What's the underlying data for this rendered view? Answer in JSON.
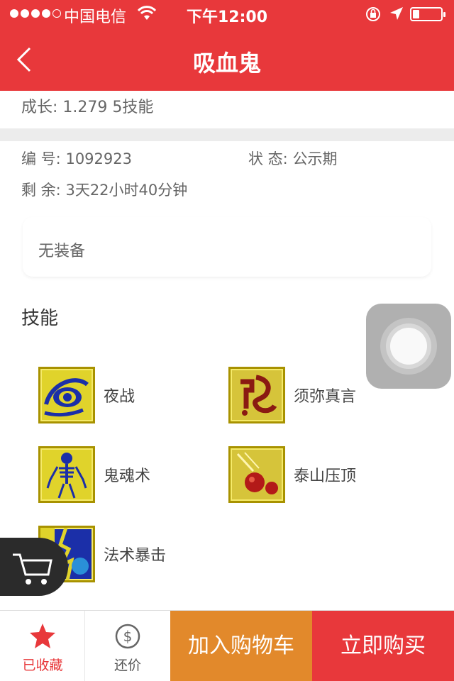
{
  "status_bar": {
    "carrier": "中国电信",
    "time": "下午12:00",
    "signal_level": 4,
    "battery_percent": 15
  },
  "nav": {
    "title": "吸血鬼",
    "back_icon": "chevron-left-icon"
  },
  "summary": {
    "growth": "成长: 1.279   5技能"
  },
  "info": {
    "id_label": "编  号:",
    "id_value": "1092923",
    "state_label": "状  态:",
    "state_value": "公示期",
    "remaining_label": "剩  余:",
    "remaining_value": "3天22小时40分钟"
  },
  "equipment": {
    "text": "无装备"
  },
  "skills": {
    "title": "技能",
    "items": [
      {
        "name": "夜战",
        "icon": "eye-icon"
      },
      {
        "name": "须弥真言",
        "icon": "rune-icon"
      },
      {
        "name": "鬼魂术",
        "icon": "skeleton-icon"
      },
      {
        "name": "泰山压顶",
        "icon": "meteor-icon"
      },
      {
        "name": "法术暴击",
        "icon": "lightning-icon"
      }
    ]
  },
  "bottom_bar": {
    "favorite_label": "已收藏",
    "bargain_label": "还价",
    "add_to_cart_label": "加入购物车",
    "buy_now_label": "立即购买"
  },
  "colors": {
    "primary_red": "#e8383b",
    "orange": "#e2892b",
    "skill_icon_bg": "#e0d32b"
  }
}
